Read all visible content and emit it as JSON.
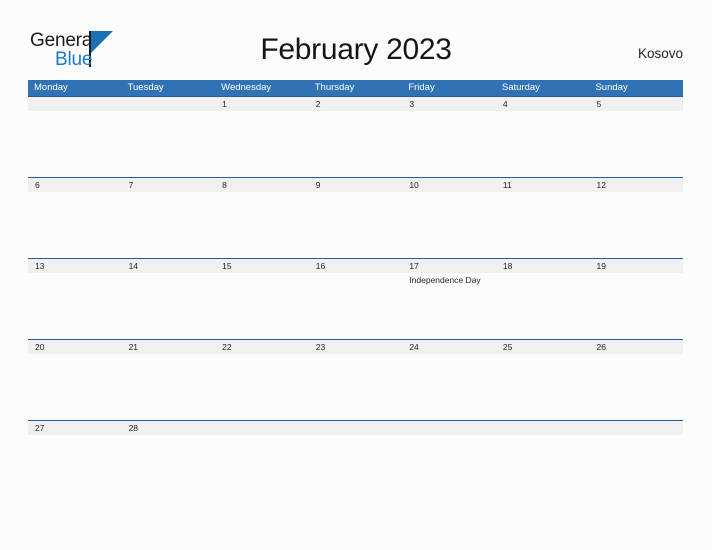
{
  "brand": {
    "name_part1": "General",
    "name_part2": "Blue",
    "triangle_color": "#1b6fb5",
    "blue_color": "#1b7ac2"
  },
  "header": {
    "title": "February 2023",
    "region": "Kosovo"
  },
  "theme": {
    "header_blue": "#3072b4",
    "row_divider_blue": "#215e9b",
    "band_gray": "#f0f0f0",
    "page_bg": "#fcfcfc"
  },
  "calendar": {
    "day_names": [
      "Monday",
      "Tuesday",
      "Wednesday",
      "Thursday",
      "Friday",
      "Saturday",
      "Sunday"
    ],
    "weeks": [
      {
        "days": [
          {
            "num": "",
            "event": ""
          },
          {
            "num": "",
            "event": ""
          },
          {
            "num": "1",
            "event": ""
          },
          {
            "num": "2",
            "event": ""
          },
          {
            "num": "3",
            "event": ""
          },
          {
            "num": "4",
            "event": ""
          },
          {
            "num": "5",
            "event": ""
          }
        ]
      },
      {
        "days": [
          {
            "num": "6",
            "event": ""
          },
          {
            "num": "7",
            "event": ""
          },
          {
            "num": "8",
            "event": ""
          },
          {
            "num": "9",
            "event": ""
          },
          {
            "num": "10",
            "event": ""
          },
          {
            "num": "11",
            "event": ""
          },
          {
            "num": "12",
            "event": ""
          }
        ]
      },
      {
        "days": [
          {
            "num": "13",
            "event": ""
          },
          {
            "num": "14",
            "event": ""
          },
          {
            "num": "15",
            "event": ""
          },
          {
            "num": "16",
            "event": ""
          },
          {
            "num": "17",
            "event": "Independence Day"
          },
          {
            "num": "18",
            "event": ""
          },
          {
            "num": "19",
            "event": ""
          }
        ]
      },
      {
        "days": [
          {
            "num": "20",
            "event": ""
          },
          {
            "num": "21",
            "event": ""
          },
          {
            "num": "22",
            "event": ""
          },
          {
            "num": "23",
            "event": ""
          },
          {
            "num": "24",
            "event": ""
          },
          {
            "num": "25",
            "event": ""
          },
          {
            "num": "26",
            "event": ""
          }
        ]
      },
      {
        "days": [
          {
            "num": "27",
            "event": ""
          },
          {
            "num": "28",
            "event": ""
          },
          {
            "num": "",
            "event": ""
          },
          {
            "num": "",
            "event": ""
          },
          {
            "num": "",
            "event": ""
          },
          {
            "num": "",
            "event": ""
          },
          {
            "num": "",
            "event": ""
          }
        ]
      }
    ]
  }
}
